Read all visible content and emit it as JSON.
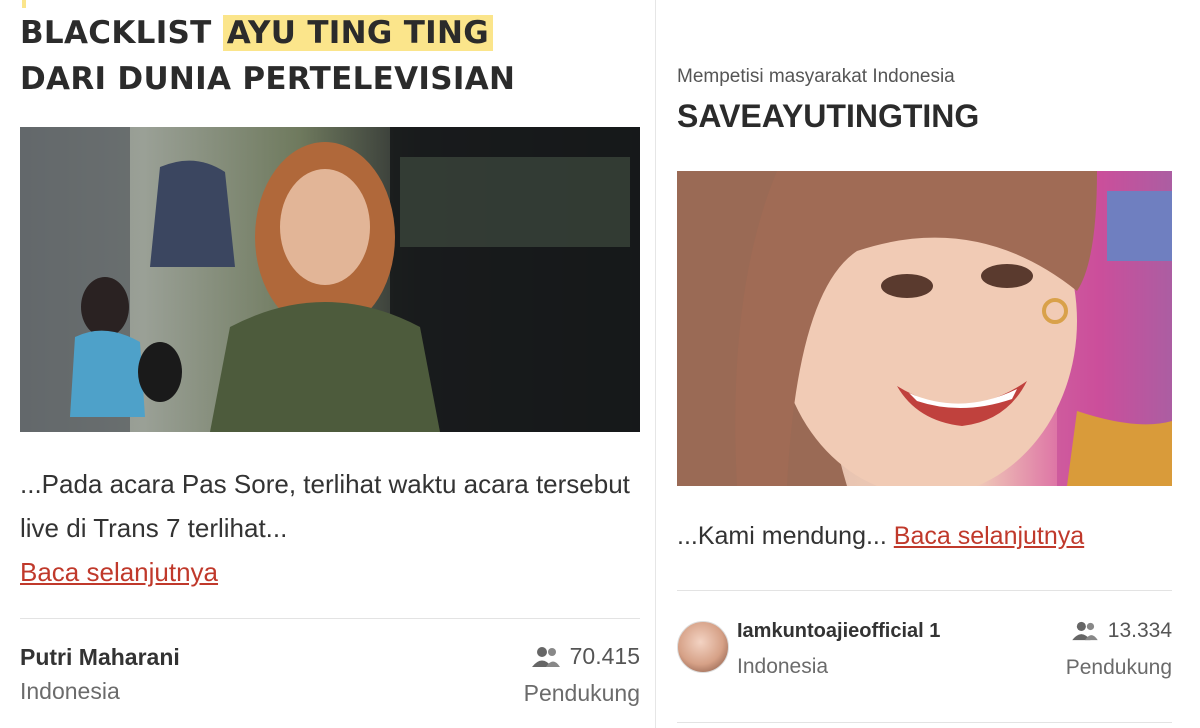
{
  "left_card": {
    "title_part1": "BLACKLIST ",
    "title_highlight": "AYU TING TING",
    "title_part2": "DARI DUNIA PERTELEVISIAN",
    "excerpt": "...Pada acara Pas Sore, terlihat waktu acara tersebut live di Trans 7 terlihat...",
    "read_more": "Baca selanjutnya",
    "author": "Putri Maharani",
    "location": "Indonesia",
    "supporters": "70.415",
    "supporters_label": "Pendukung"
  },
  "right_card": {
    "subtitle": "Mempetisi masyarakat Indonesia",
    "title": "SAVEAYUTINGTING",
    "excerpt": "...Kami mendung...",
    "read_more": "Baca selanjutnya",
    "author": "Iamkuntoajieofficial 1",
    "location": "Indonesia",
    "supporters": "13.334",
    "supporters_label": "Pendukung"
  },
  "colors": {
    "highlight": "#fbe58b",
    "link": "#c0392b"
  },
  "icons": {
    "people": "people-icon"
  }
}
